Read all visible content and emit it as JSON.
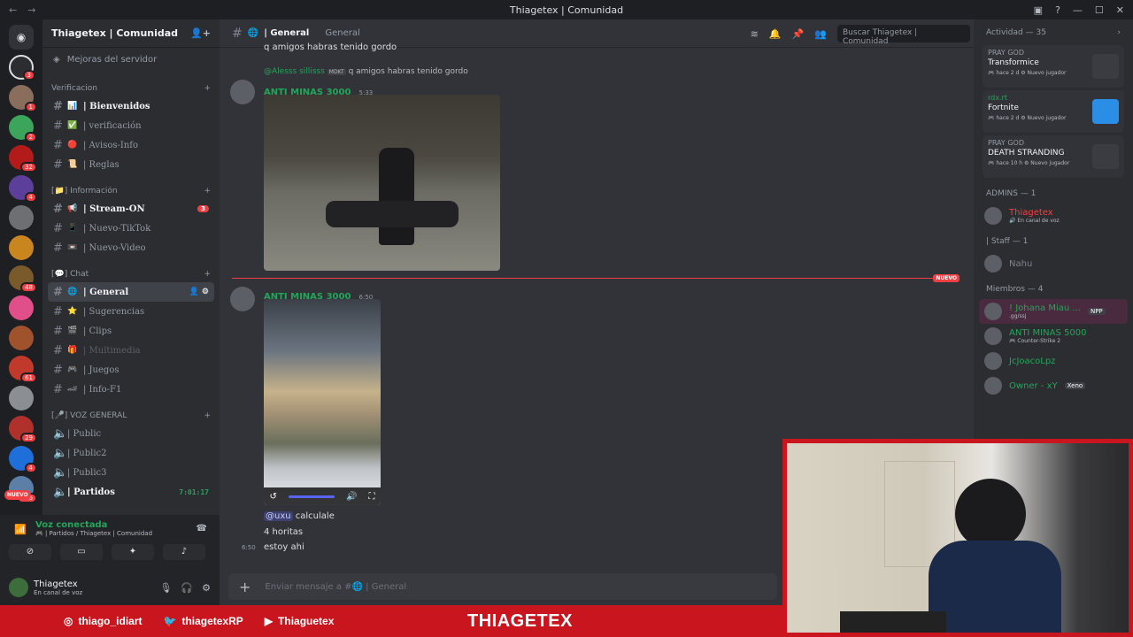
{
  "window": {
    "title": "Thiagetex | Comunidad"
  },
  "server_list": {
    "badges": [
      "3",
      "1",
      "2",
      "32",
      "4",
      "",
      "",
      "48",
      "",
      "",
      "61",
      "29",
      "4",
      "556",
      ""
    ],
    "new_label": "NUEVO"
  },
  "sidebar": {
    "guild_name": "Thiagetex | Comunidad",
    "boost_label": "Mejoras del servidor",
    "categories": {
      "verif": "Verificacion",
      "info": "[📁] Información",
      "chat": "[💬] Chat",
      "voz": "[🎤] VOZ GENERAL"
    },
    "channels": [
      {
        "emoji": "📊",
        "label": "| Bienvenidos"
      },
      {
        "emoji": "✅",
        "label": "| verificación"
      },
      {
        "emoji": "🔴",
        "label": "| Avisos-Info"
      },
      {
        "emoji": "📜",
        "label": "| Reglas"
      },
      {
        "emoji": "📢",
        "label": "| Stream-ON",
        "count": "3"
      },
      {
        "emoji": "📱",
        "label": "| Nuevo-TikTok"
      },
      {
        "emoji": "📼",
        "label": "| Nuevo-Video"
      },
      {
        "emoji": "🌐",
        "label": "| General"
      },
      {
        "emoji": "⭐",
        "label": "| Sugerencias"
      },
      {
        "emoji": "🎬",
        "label": "| Clips"
      },
      {
        "emoji": "🎁",
        "label": "| Multimedia"
      },
      {
        "emoji": "🎮",
        "label": "| Juegos"
      },
      {
        "emoji": "🏎",
        "label": "| Info-F1"
      }
    ],
    "voice": [
      {
        "label": "| Public"
      },
      {
        "label": "| Public2"
      },
      {
        "label": "| Public3"
      },
      {
        "label": "| Partidos",
        "time": "7:01:17"
      }
    ]
  },
  "voice_status": {
    "title": "Voz conectada",
    "sub": "🎮 | Partidos / Thiagetex | Comunidad"
  },
  "user": {
    "name": "Thiagetex",
    "status": "En canal de voz"
  },
  "channel_header": {
    "name": "| General",
    "topic": "General",
    "search_placeholder": "Buscar Thiagetex | Comunidad"
  },
  "messages": {
    "top_line": "q amigos habras tenido gordo",
    "reply_author": "@Alesss sillisss",
    "reply_tag": "MDKT",
    "reply_text": "q amigos habras tenido gordo",
    "msg1": {
      "author": "ANTI MINAS 3000",
      "time": "5:33"
    },
    "new_label": "NUEVO",
    "msg2": {
      "author": "ANTI MINAS 3000",
      "time": "6:50"
    },
    "lines": [
      {
        "mention": "@uxu",
        "text": " calculale"
      },
      {
        "text": "4 horitas"
      },
      {
        "time": "6:50",
        "text": "estoy ahi"
      }
    ]
  },
  "composer": {
    "placeholder": "Enviar mensaje a #🌐 | General"
  },
  "members": {
    "activity_header": "Actividad — 35",
    "activities": [
      {
        "who": "PRAY GOD",
        "game": "Transformice",
        "meta": "🎮 hace 2 d   ⚙ Nuevo jugador"
      },
      {
        "who": "rdx.rt",
        "game": "Fortnite",
        "meta": "🎮 hace 2 d   ⚙ Nuevo jugador"
      },
      {
        "who": "PRAY GOD",
        "game": "DEATH STRANDING",
        "meta": "🎮 hace 10 h   ⚙ Nuevo jugador"
      }
    ],
    "admins_header": "ADMINS — 1",
    "admins": [
      {
        "name": "Thiagetex",
        "sub": "🔊 En canal de voz"
      }
    ],
    "staff_header": "| Staff — 1",
    "staff": [
      {
        "name": "Nahu",
        "sub": ""
      }
    ],
    "members_header": "Miembros — 4",
    "list": [
      {
        "name": "! Johana Miau ...",
        "sub": ".gg/ssj",
        "tag": "NPP"
      },
      {
        "name": "ANTI MINAS 5000",
        "sub": "🎮 Counter-Strike 2"
      },
      {
        "name": "JcJoacoLpz",
        "sub": ""
      },
      {
        "name": "Owner - xY",
        "sub": "",
        "tag": "Xeno"
      }
    ]
  },
  "overlay": {
    "instagram": "thiago_idiart",
    "twitter": "thiagetexRP",
    "youtube": "Thiaguetex",
    "brand": "THIAGETEX"
  }
}
